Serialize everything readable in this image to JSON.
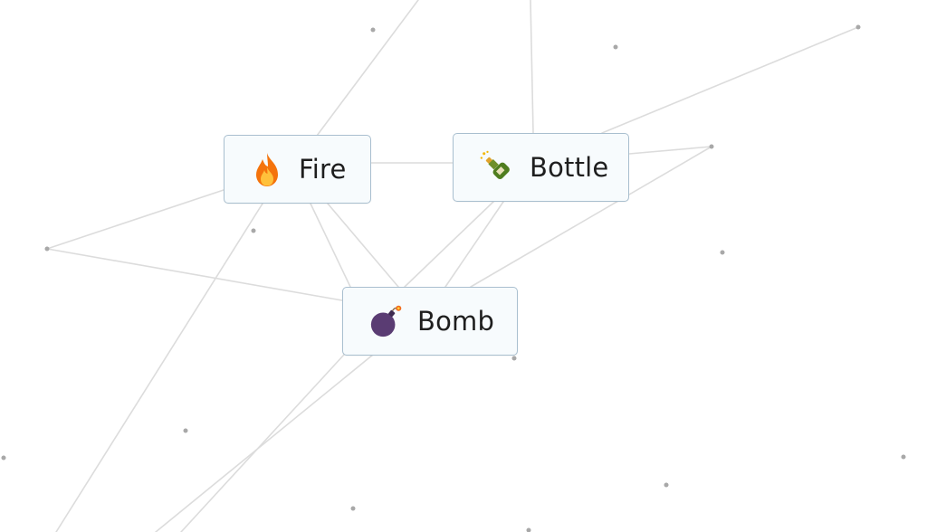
{
  "elements": [
    {
      "label": "Fire",
      "icon": "fire-icon"
    },
    {
      "label": "Bottle",
      "icon": "bottle-icon"
    },
    {
      "label": "Bomb",
      "icon": "bomb-icon"
    }
  ],
  "colors": {
    "background": "#ffffff",
    "tile_background": "#f7fbfd",
    "tile_border": "#a9bfcf",
    "line": "#d9d9d9",
    "dot": "#a8a8a8"
  }
}
